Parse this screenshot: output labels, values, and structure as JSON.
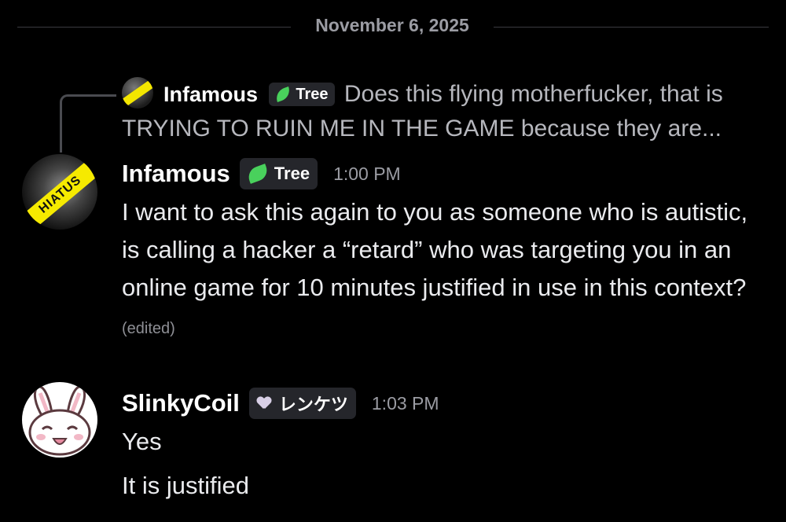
{
  "date_divider": "November 6, 2025",
  "reply": {
    "author": "Infamous",
    "tag": "Tree",
    "preview": "Does this flying motherfucker, that is TRYING TO RUIN ME IN THE GAME because they are..."
  },
  "messages": [
    {
      "author": "Infamous",
      "tag": "Tree",
      "avatar_label": "HIATUS",
      "time": "1:00 PM",
      "lines": [
        "I want to ask this again to you as someone who is autistic, is calling a hacker a “retard” who was targeting you in an online game for 10 minutes justified in use in this context?"
      ],
      "edited_label": "(edited)"
    },
    {
      "author": "SlinkyCoil",
      "tag": "レンケツ",
      "time": "1:03 PM",
      "lines": [
        "Yes",
        "It is justified"
      ]
    }
  ],
  "colors": {
    "background": "#000000",
    "tree_leaf": "#49d15c",
    "tag_bg": "#25262b",
    "hiatus_tape": "#f6ea00"
  }
}
